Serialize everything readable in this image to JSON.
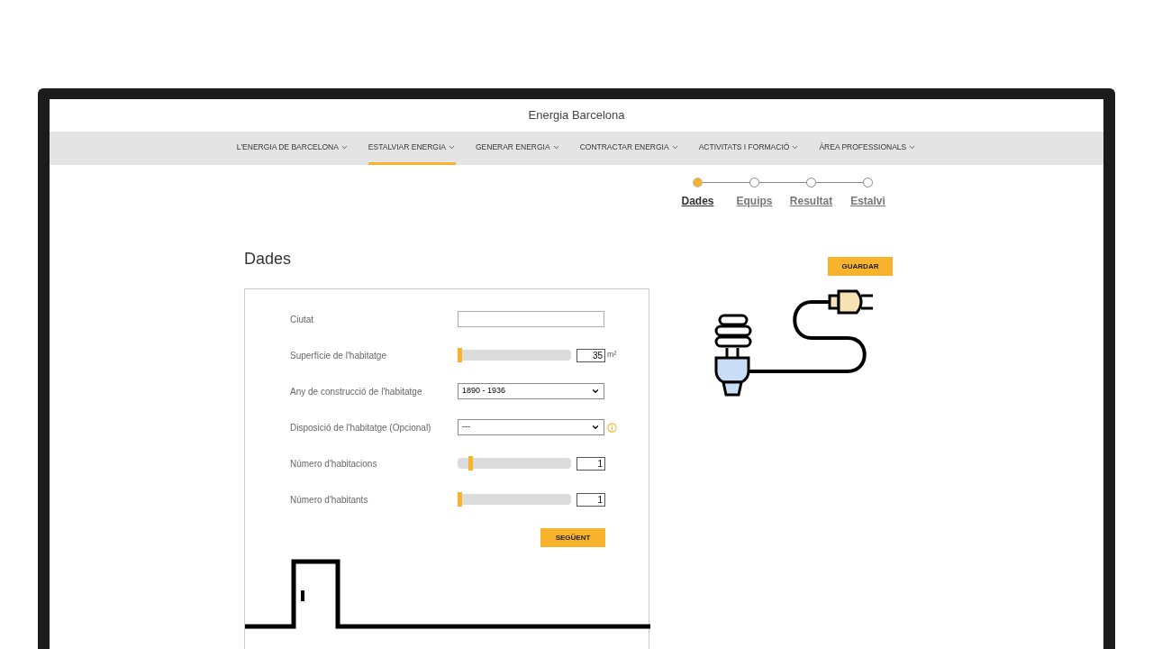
{
  "site_title": "Energia Barcelona",
  "nav": [
    {
      "label": "L'ENERGIA DE BARCELONA",
      "selected": false
    },
    {
      "label": "ESTALVIAR ENERGIA",
      "selected": true
    },
    {
      "label": "GENERAR ENERGIA",
      "selected": false
    },
    {
      "label": "CONTRACTAR ENERGIA",
      "selected": false
    },
    {
      "label": "ACTIVITATS I FORMACIÓ",
      "selected": false
    },
    {
      "label": "ÀREA PROFESSIONALS",
      "selected": false
    }
  ],
  "steps": [
    {
      "label": "Dades",
      "selected": true
    },
    {
      "label": "Equips",
      "selected": false
    },
    {
      "label": "Resultat",
      "selected": false
    },
    {
      "label": "Estalvi",
      "selected": false
    }
  ],
  "heading": "Dades",
  "save_button": "GUARDAR",
  "fields": [
    {
      "kind": "text",
      "label": "Ciutat"
    },
    {
      "kind": "slider",
      "label": "Superfície de l'habitatge",
      "level": 0,
      "value": "35",
      "unit": "m²"
    },
    {
      "kind": "select",
      "label": "Any de construcció de l'habitatge",
      "value": "1890 - 1936",
      "info": false
    },
    {
      "kind": "select",
      "label": "Disposició de l'habitatge (Opcional)",
      "value": "---",
      "info": true
    },
    {
      "kind": "slider",
      "label": "Número d'habitacions",
      "level": 0.1,
      "value": "1"
    },
    {
      "kind": "slider",
      "label": "Número d'habitants",
      "level": 0,
      "value": "1"
    }
  ],
  "next_button": "SEGÜENT"
}
